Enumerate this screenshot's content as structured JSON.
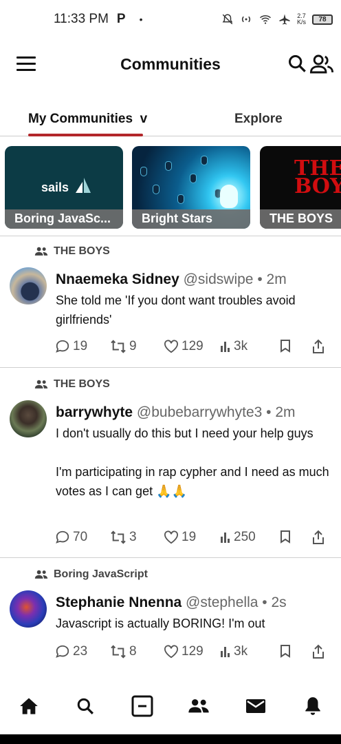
{
  "status_bar": {
    "time": "11:33 PM",
    "p_icon": "P",
    "dot": "•",
    "net_speed": "2.7",
    "net_unit": "K/s",
    "battery": "78"
  },
  "app_bar": {
    "title": "Communities",
    "icons": [
      "menu-icon",
      "search-icon",
      "people-icon"
    ]
  },
  "tabs": [
    {
      "label": "My Communities  v",
      "active": true
    },
    {
      "label": "Explore",
      "active": false
    }
  ],
  "accent_color": "#b3262a",
  "communities": [
    {
      "label": "Boring JavaSc...",
      "logo_text": "sails"
    },
    {
      "label": "Bright Stars"
    },
    {
      "label": "THE BOYS",
      "logo_text": "THE BOYS"
    }
  ],
  "posts": [
    {
      "community": "THE BOYS",
      "name": "Nnaemeka Sidney",
      "handle": "@sidswipe",
      "sep": "•",
      "time": "2m",
      "body": "She told me 'If you dont want troubles avoid girlfriends'",
      "replies": "19",
      "reposts": "9",
      "likes": "129",
      "views": "3k"
    },
    {
      "community": "THE BOYS",
      "name": "barrywhyte",
      "handle": "@bubebarrywhyte3",
      "sep": "•",
      "time": "2m",
      "body": "I don't usually do this but I need your help guys\n\nI'm participating in rap cypher and I need as much votes as I can get 🙏🙏",
      "replies": "70",
      "reposts": "3",
      "likes": "19",
      "views": "250"
    },
    {
      "community": "Boring JavaScript",
      "name": "Stephanie Nnenna",
      "handle": "@stephella",
      "sep": "•",
      "time": "2s",
      "body": "Javascript is actually BORING! I'm out",
      "replies": "23",
      "reposts": "8",
      "likes": "129",
      "views": "3k"
    }
  ],
  "bottom_nav": [
    "home-icon",
    "search-icon",
    "compose-icon",
    "communities-icon",
    "messages-icon",
    "notifications-icon"
  ]
}
